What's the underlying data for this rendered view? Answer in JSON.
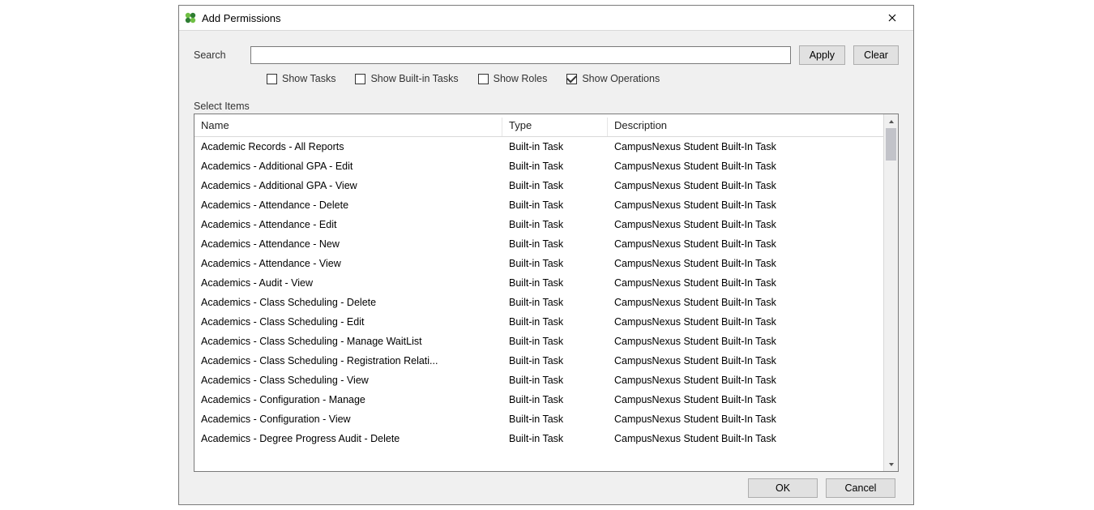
{
  "window": {
    "title": "Add Permissions",
    "close_tooltip": "Close"
  },
  "search": {
    "label": "Search",
    "value": "",
    "apply": "Apply",
    "clear": "Clear"
  },
  "filters": {
    "show_tasks": {
      "label": "Show Tasks",
      "checked": false
    },
    "show_builtin_tasks": {
      "label": "Show Built-in Tasks",
      "checked": false
    },
    "show_roles": {
      "label": "Show Roles",
      "checked": false
    },
    "show_operations": {
      "label": "Show Operations",
      "checked": true
    }
  },
  "select_items_label": "Select Items",
  "columns": {
    "name": "Name",
    "type": "Type",
    "description": "Description"
  },
  "rows": [
    {
      "name": "Academic Records - All Reports",
      "type": "Built-in Task",
      "description": "CampusNexus Student Built-In Task"
    },
    {
      "name": "Academics - Additional GPA - Edit",
      "type": "Built-in Task",
      "description": "CampusNexus Student Built-In Task"
    },
    {
      "name": "Academics - Additional GPA - View",
      "type": "Built-in Task",
      "description": "CampusNexus Student Built-In Task"
    },
    {
      "name": "Academics - Attendance - Delete",
      "type": "Built-in Task",
      "description": "CampusNexus Student Built-In Task"
    },
    {
      "name": "Academics - Attendance - Edit",
      "type": "Built-in Task",
      "description": "CampusNexus Student Built-In Task"
    },
    {
      "name": "Academics - Attendance - New",
      "type": "Built-in Task",
      "description": "CampusNexus Student Built-In Task"
    },
    {
      "name": "Academics - Attendance - View",
      "type": "Built-in Task",
      "description": "CampusNexus Student Built-In Task"
    },
    {
      "name": "Academics - Audit - View",
      "type": "Built-in Task",
      "description": "CampusNexus Student Built-In Task"
    },
    {
      "name": "Academics - Class Scheduling - Delete",
      "type": "Built-in Task",
      "description": "CampusNexus Student Built-In Task"
    },
    {
      "name": "Academics - Class Scheduling - Edit",
      "type": "Built-in Task",
      "description": "CampusNexus Student Built-In Task"
    },
    {
      "name": "Academics - Class Scheduling - Manage WaitList",
      "type": "Built-in Task",
      "description": "CampusNexus Student Built-In Task"
    },
    {
      "name": "Academics - Class Scheduling - Registration Relati...",
      "type": "Built-in Task",
      "description": "CampusNexus Student Built-In Task"
    },
    {
      "name": "Academics - Class Scheduling - View",
      "type": "Built-in Task",
      "description": "CampusNexus Student Built-In Task"
    },
    {
      "name": "Academics - Configuration - Manage",
      "type": "Built-in Task",
      "description": "CampusNexus Student Built-In Task"
    },
    {
      "name": "Academics - Configuration - View",
      "type": "Built-in Task",
      "description": "CampusNexus Student Built-In Task"
    },
    {
      "name": "Academics - Degree Progress Audit - Delete",
      "type": "Built-in Task",
      "description": "CampusNexus Student Built-In Task"
    }
  ],
  "footer": {
    "ok": "OK",
    "cancel": "Cancel"
  }
}
